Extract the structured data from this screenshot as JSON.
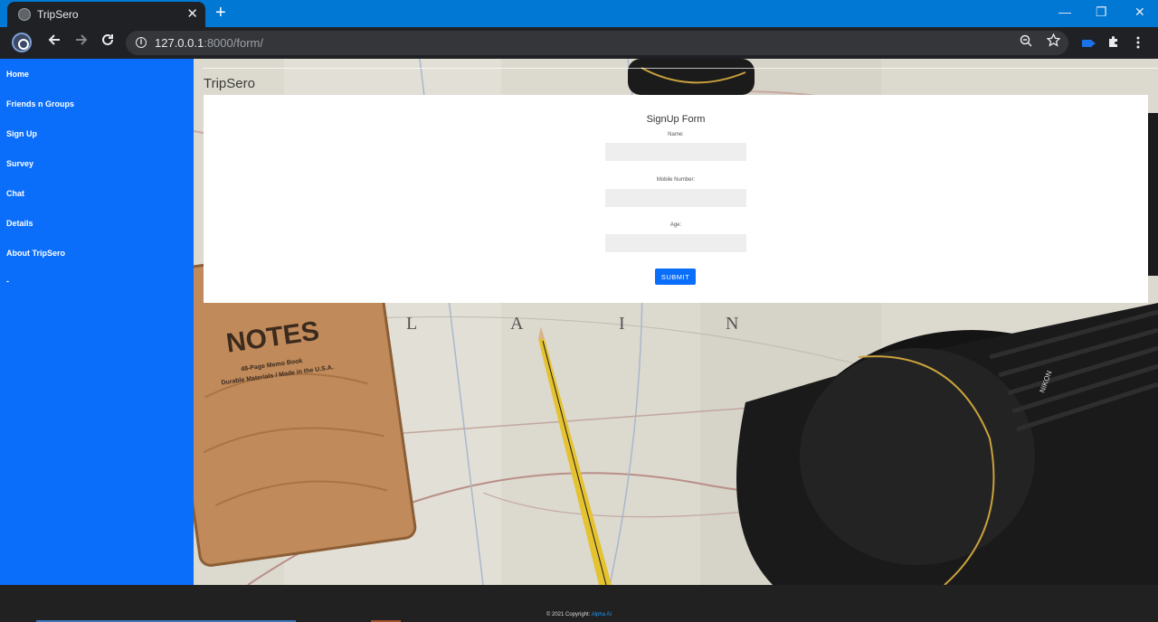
{
  "browser": {
    "tab_title": "TripSero",
    "tab_close": "✕",
    "new_tab": "+",
    "url_host": "127.0.0.1",
    "url_path": ":8000/form/",
    "window_controls": {
      "minimize": "—",
      "maximize": "❐",
      "close": "✕"
    }
  },
  "sidebar": {
    "items": [
      {
        "label": "Home"
      },
      {
        "label": "Friends n Groups"
      },
      {
        "label": "Sign Up"
      },
      {
        "label": "Survey"
      },
      {
        "label": "Chat"
      },
      {
        "label": "Details"
      },
      {
        "label": "About TripSero"
      },
      {
        "label": "-"
      }
    ]
  },
  "main": {
    "brand": "TripSero",
    "form": {
      "title": "SignUp Form",
      "fields": [
        {
          "label": "Name:",
          "value": ""
        },
        {
          "label": "Mobile Number:",
          "value": ""
        },
        {
          "label": "Age:",
          "value": ""
        }
      ],
      "submit_label": "SUBMIT"
    },
    "background_text": {
      "notes": "NOTES",
      "memo": "48-Page Memo Book",
      "materials": "Durable Materials / Made in the U.S.A."
    }
  },
  "footer": {
    "copyright": "© 2021 Copyright:",
    "author": "Alpha AI"
  },
  "colors": {
    "sidebar": "#0a6efb",
    "titlebar": "#0078d4",
    "submit": "#0a6efb",
    "footer": "#212121"
  }
}
